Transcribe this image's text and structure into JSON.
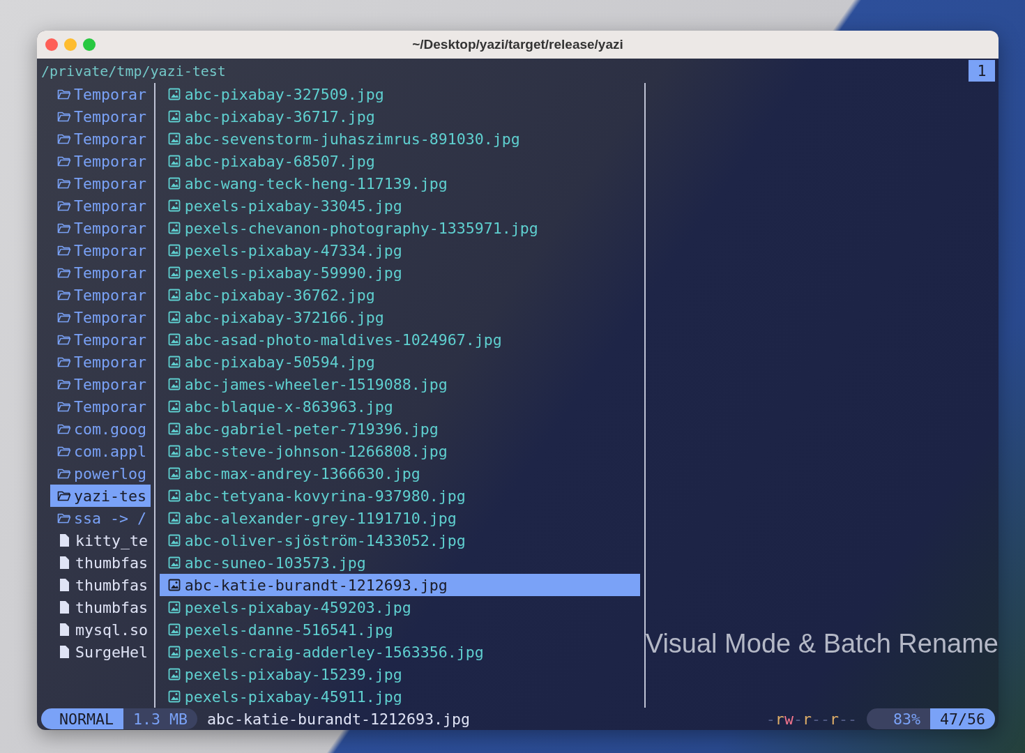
{
  "window": {
    "title": "~/Desktop/yazi/target/release/yazi"
  },
  "header": {
    "path": "/private/tmp/yazi-test",
    "tab": "1"
  },
  "parent_list": [
    {
      "name": "Temporar",
      "kind": "folder",
      "selected": false
    },
    {
      "name": "Temporar",
      "kind": "folder",
      "selected": false
    },
    {
      "name": "Temporar",
      "kind": "folder",
      "selected": false
    },
    {
      "name": "Temporar",
      "kind": "folder",
      "selected": false
    },
    {
      "name": "Temporar",
      "kind": "folder",
      "selected": false
    },
    {
      "name": "Temporar",
      "kind": "folder",
      "selected": false
    },
    {
      "name": "Temporar",
      "kind": "folder",
      "selected": false
    },
    {
      "name": "Temporar",
      "kind": "folder",
      "selected": false
    },
    {
      "name": "Temporar",
      "kind": "folder",
      "selected": false
    },
    {
      "name": "Temporar",
      "kind": "folder",
      "selected": false
    },
    {
      "name": "Temporar",
      "kind": "folder",
      "selected": false
    },
    {
      "name": "Temporar",
      "kind": "folder",
      "selected": false
    },
    {
      "name": "Temporar",
      "kind": "folder",
      "selected": false
    },
    {
      "name": "Temporar",
      "kind": "folder",
      "selected": false
    },
    {
      "name": "Temporar",
      "kind": "folder",
      "selected": false
    },
    {
      "name": "com.goog",
      "kind": "folder",
      "selected": false
    },
    {
      "name": "com.appl",
      "kind": "folder",
      "selected": false
    },
    {
      "name": "powerlog",
      "kind": "folder",
      "selected": false
    },
    {
      "name": "yazi-tes",
      "kind": "folder",
      "selected": true
    },
    {
      "name": "ssa -> /",
      "kind": "folder",
      "selected": false
    },
    {
      "name": "kitty_te",
      "kind": "file",
      "selected": false
    },
    {
      "name": "thumbfas",
      "kind": "file",
      "selected": false
    },
    {
      "name": "thumbfas",
      "kind": "file",
      "selected": false
    },
    {
      "name": "thumbfas",
      "kind": "file",
      "selected": false
    },
    {
      "name": "mysql.so",
      "kind": "file",
      "selected": false
    },
    {
      "name": "SurgeHel",
      "kind": "file",
      "selected": false
    }
  ],
  "current_list": [
    {
      "name": "abc-pixabay-327509.jpg",
      "selected": false
    },
    {
      "name": "abc-pixabay-36717.jpg",
      "selected": false
    },
    {
      "name": "abc-sevenstorm-juhaszimrus-891030.jpg",
      "selected": false
    },
    {
      "name": "abc-pixabay-68507.jpg",
      "selected": false
    },
    {
      "name": "abc-wang-teck-heng-117139.jpg",
      "selected": false
    },
    {
      "name": "pexels-pixabay-33045.jpg",
      "selected": false
    },
    {
      "name": "pexels-chevanon-photography-1335971.jpg",
      "selected": false
    },
    {
      "name": "pexels-pixabay-47334.jpg",
      "selected": false
    },
    {
      "name": "pexels-pixabay-59990.jpg",
      "selected": false
    },
    {
      "name": "abc-pixabay-36762.jpg",
      "selected": false
    },
    {
      "name": "abc-pixabay-372166.jpg",
      "selected": false
    },
    {
      "name": "abc-asad-photo-maldives-1024967.jpg",
      "selected": false
    },
    {
      "name": "abc-pixabay-50594.jpg",
      "selected": false
    },
    {
      "name": "abc-james-wheeler-1519088.jpg",
      "selected": false
    },
    {
      "name": "abc-blaque-x-863963.jpg",
      "selected": false
    },
    {
      "name": "abc-gabriel-peter-719396.jpg",
      "selected": false
    },
    {
      "name": "abc-steve-johnson-1266808.jpg",
      "selected": false
    },
    {
      "name": "abc-max-andrey-1366630.jpg",
      "selected": false
    },
    {
      "name": "abc-tetyana-kovyrina-937980.jpg",
      "selected": false
    },
    {
      "name": "abc-alexander-grey-1191710.jpg",
      "selected": false
    },
    {
      "name": "abc-oliver-sjöström-1433052.jpg",
      "selected": false
    },
    {
      "name": "abc-suneo-103573.jpg",
      "selected": false
    },
    {
      "name": "abc-katie-burandt-1212693.jpg",
      "selected": true
    },
    {
      "name": "pexels-pixabay-459203.jpg",
      "selected": false
    },
    {
      "name": "pexels-danne-516541.jpg",
      "selected": false
    },
    {
      "name": "pexels-craig-adderley-1563356.jpg",
      "selected": false
    },
    {
      "name": "pexels-pixabay-15239.jpg",
      "selected": false
    },
    {
      "name": "pexels-pixabay-45911.jpg",
      "selected": false
    }
  ],
  "status_bar": {
    "mode": "NORMAL",
    "size": "1.3 MB",
    "file": "abc-katie-burandt-1212693.jpg",
    "permissions": [
      {
        "text": "-",
        "kind": "dash"
      },
      {
        "text": "r",
        "kind": "read"
      },
      {
        "text": "w",
        "kind": "write"
      },
      {
        "text": "-",
        "kind": "dash"
      },
      {
        "text": "r",
        "kind": "read"
      },
      {
        "text": "--",
        "kind": "dash"
      },
      {
        "text": "r",
        "kind": "read"
      },
      {
        "text": "--",
        "kind": "dash"
      }
    ],
    "percent": "83%",
    "position": "47/56"
  },
  "caption": "Visual Mode & Batch Rename"
}
